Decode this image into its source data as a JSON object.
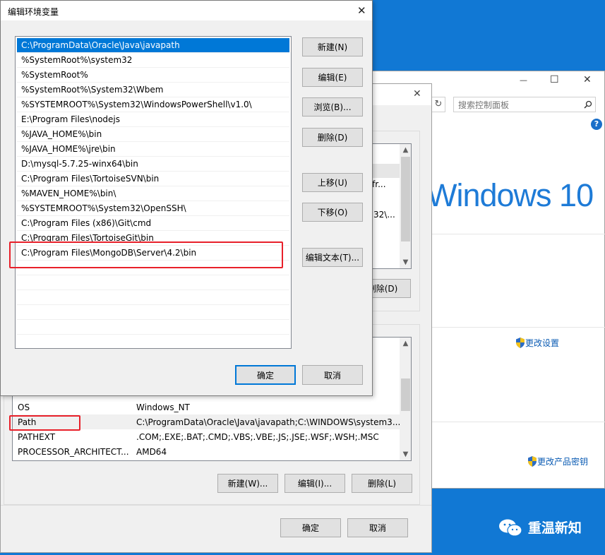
{
  "colors": {
    "desktop": "#1178d4",
    "accent": "#0078d7",
    "highlight_red": "#e8202a",
    "selection": "#0078d7"
  },
  "control_panel": {
    "search_placeholder": "搜索控制面板",
    "windows_brand": "Windows 10",
    "change_settings": "更改设置",
    "change_product_key": "更改产品密钥",
    "minimize_glyph": "—",
    "maximize_glyph": "☐",
    "close_glyph": "✕",
    "help_glyph": "?"
  },
  "sysprops": {
    "close_glyph": "✕",
    "user_fragment_1": "\\fr...",
    "user_fragment_2": "32\\...",
    "user_delete_partial": "删除(D)",
    "system_vars": [
      {
        "name": "OS",
        "value": "Windows_NT"
      },
      {
        "name": "Path",
        "value": "C:\\ProgramData\\Oracle\\Java\\javapath;C:\\WINDOWS\\system3..."
      },
      {
        "name": "PATHEXT",
        "value": ".COM;.EXE;.BAT;.CMD;.VBS;.VBE;.JS;.JSE;.WSF;.WSH;.MSC"
      },
      {
        "name": "PROCESSOR_ARCHITECT...",
        "value": "AMD64"
      }
    ],
    "new_button": "新建(W)...",
    "edit_button": "编辑(I)...",
    "delete_button": "删除(L)",
    "ok_button": "确定",
    "cancel_button": "取消"
  },
  "edit_dialog": {
    "title": "编辑环境变量",
    "close_glyph": "✕",
    "paths": [
      "C:\\ProgramData\\Oracle\\Java\\javapath",
      "%SystemRoot%\\system32",
      "%SystemRoot%",
      "%SystemRoot%\\System32\\Wbem",
      "%SYSTEMROOT%\\System32\\WindowsPowerShell\\v1.0\\",
      "E:\\Program Files\\nodejs",
      "%JAVA_HOME%\\bin",
      "%JAVA_HOME%\\jre\\bin",
      "D:\\mysql-5.7.25-winx64\\bin",
      "C:\\Program Files\\TortoiseSVN\\bin",
      "%MAVEN_HOME%\\bin\\",
      "%SYSTEMROOT%\\System32\\OpenSSH\\",
      "C:\\Program Files (x86)\\Git\\cmd",
      "C:\\Program Files\\TortoiseGit\\bin",
      "C:\\Program Files\\MongoDB\\Server\\4.2\\bin"
    ],
    "buttons": {
      "new": "新建(N)",
      "edit": "编辑(E)",
      "browse": "浏览(B)...",
      "delete": "删除(D)",
      "move_up": "上移(U)",
      "move_down": "下移(O)",
      "edit_text": "编辑文本(T)...",
      "ok": "确定",
      "cancel": "取消"
    }
  },
  "watermark": {
    "text": "重温新知"
  }
}
